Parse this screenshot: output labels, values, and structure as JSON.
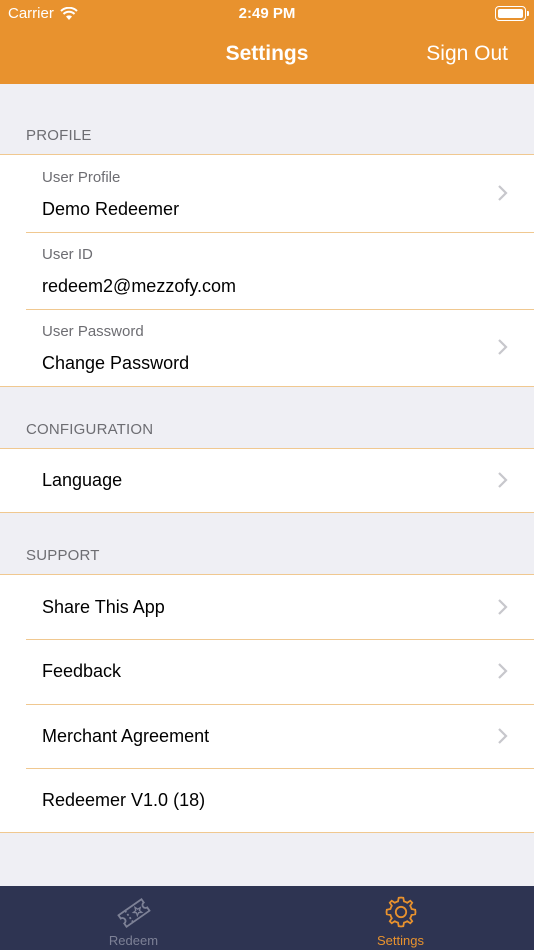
{
  "status": {
    "carrier": "Carrier",
    "time": "2:49 PM"
  },
  "nav": {
    "title": "Settings",
    "sign_out": "Sign Out"
  },
  "profile": {
    "header": "PROFILE",
    "user_profile_label": "User Profile",
    "user_profile_value": "Demo Redeemer",
    "user_id_label": "User ID",
    "user_id_value": "redeem2@mezzofy.com",
    "password_label": "User Password",
    "password_value": "Change Password"
  },
  "configuration": {
    "header": "CONFIGURATION",
    "language": "Language"
  },
  "support": {
    "header": "SUPPORT",
    "share": "Share This App",
    "feedback": "Feedback",
    "agreement": "Merchant Agreement",
    "version": "Redeemer V1.0 (18)"
  },
  "tabs": [
    {
      "label": "Redeem",
      "icon": "ticket-icon",
      "active": false
    },
    {
      "label": "Settings",
      "icon": "gear-icon",
      "active": true
    }
  ],
  "colors": {
    "accent": "#e8922e",
    "tabbar": "#2e3452",
    "tab_inactive": "#7d8196",
    "separator": "#f0c890"
  }
}
